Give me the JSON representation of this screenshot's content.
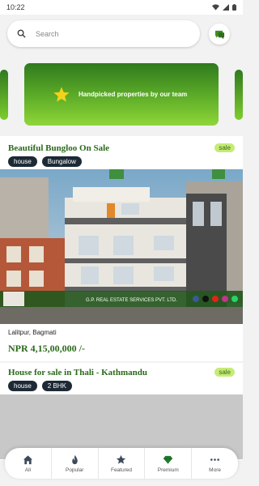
{
  "status_bar": {
    "time": "10:22"
  },
  "search": {
    "placeholder": "Search"
  },
  "banner": {
    "text": "Handpicked properties by our team"
  },
  "listings": [
    {
      "title": "Beautiful Bungloo On Sale",
      "badge": "sale",
      "tags": [
        "house",
        "Bungalow"
      ],
      "image_overlay": "G.P. REAL ESTATE SERVICES PVT. LTD.",
      "location": "Lalitpur, Bagmati",
      "price": "NPR 4,15,00,000 /-"
    },
    {
      "title": "House for sale in Thali - Kathmandu",
      "badge": "sale",
      "tags": [
        "house",
        "2 BHK"
      ]
    }
  ],
  "nav": {
    "items": [
      {
        "label": "All",
        "icon": "home-icon"
      },
      {
        "label": "Popular",
        "icon": "flame-icon"
      },
      {
        "label": "Featured",
        "icon": "star-icon"
      },
      {
        "label": "Premium",
        "icon": "diamond-icon"
      },
      {
        "label": "More",
        "icon": "more-icon"
      }
    ]
  },
  "colors": {
    "brand_green": "#2a6a1a",
    "tag_dark": "#1d2a36",
    "badge_bg": "#c6eb76"
  }
}
